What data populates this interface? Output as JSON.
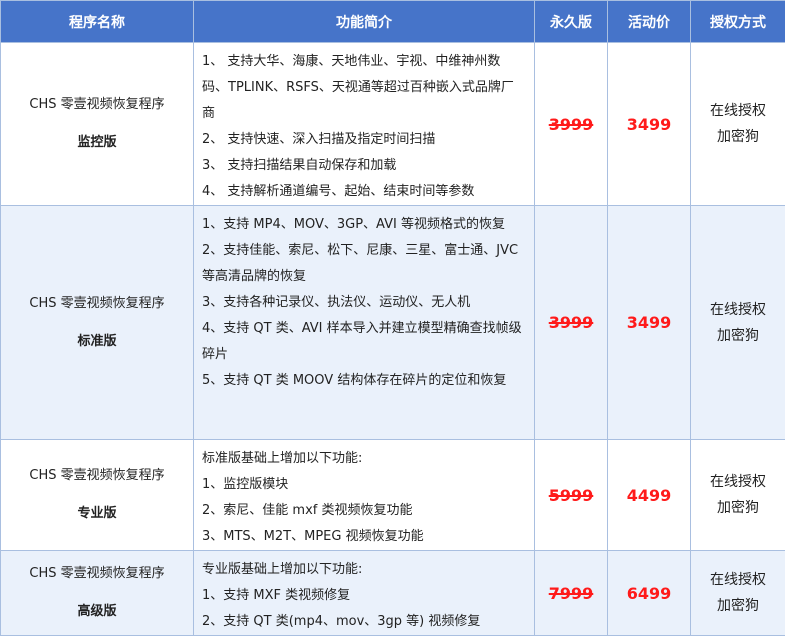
{
  "headers": [
    "程序名称",
    "功能简介",
    "永久版",
    "活动价",
    "授权方式"
  ],
  "rows": [
    {
      "product": "CHS 零壹视频恢复程序",
      "edition": "监控版",
      "features": [
        "1、  支持大华、海康、天地伟业、宇视、中维神州数码、TPLINK、RSFS、天视通等超过百种嵌入式品牌厂商",
        "2、  支持快速、深入扫描及指定时间扫描",
        "3、  支持扫描结果自动保存和加载",
        "4、  支持解析通道编号、起始、结束时间等参数"
      ],
      "original_price": "3999",
      "sale_price": "3499",
      "auth": [
        "在线授权",
        "加密狗"
      ]
    },
    {
      "product": "CHS 零壹视频恢复程序",
      "edition": "标准版",
      "features": [
        "1、支持 MP4、MOV、3GP、AVI 等视频格式的恢复",
        "2、支持佳能、索尼、松下、尼康、三星、富士通、JVC 等高清品牌的恢复",
        "3、支持各种记录仪、执法仪、运动仪、无人机",
        "4、支持 QT 类、AVI 样本导入并建立模型精确查找帧级碎片",
        "5、支持 QT 类 MOOV 结构体存在碎片的定位和恢复"
      ],
      "original_price": "3999",
      "sale_price": "3499",
      "auth": [
        "在线授权",
        "加密狗"
      ]
    },
    {
      "product": "CHS 零壹视频恢复程序",
      "edition": "专业版",
      "features": [
        "标准版基础上增加以下功能:",
        "1、监控版模块",
        "2、索尼、佳能 mxf 类视频恢复功能",
        "3、MTS、M2T、MPEG 视频恢复功能"
      ],
      "original_price": "5999",
      "sale_price": "4499",
      "auth": [
        "在线授权",
        "加密狗"
      ]
    },
    {
      "product": "CHS 零壹视频恢复程序",
      "edition": "高级版",
      "features": [
        "专业版基础上增加以下功能:",
        "1、支持 MXF 类视频修复",
        "2、支持 QT 类(mp4、mov、3gp 等) 视频修复"
      ],
      "original_price": "7999",
      "sale_price": "6499",
      "auth": [
        "在线授权",
        "加密狗"
      ]
    }
  ]
}
